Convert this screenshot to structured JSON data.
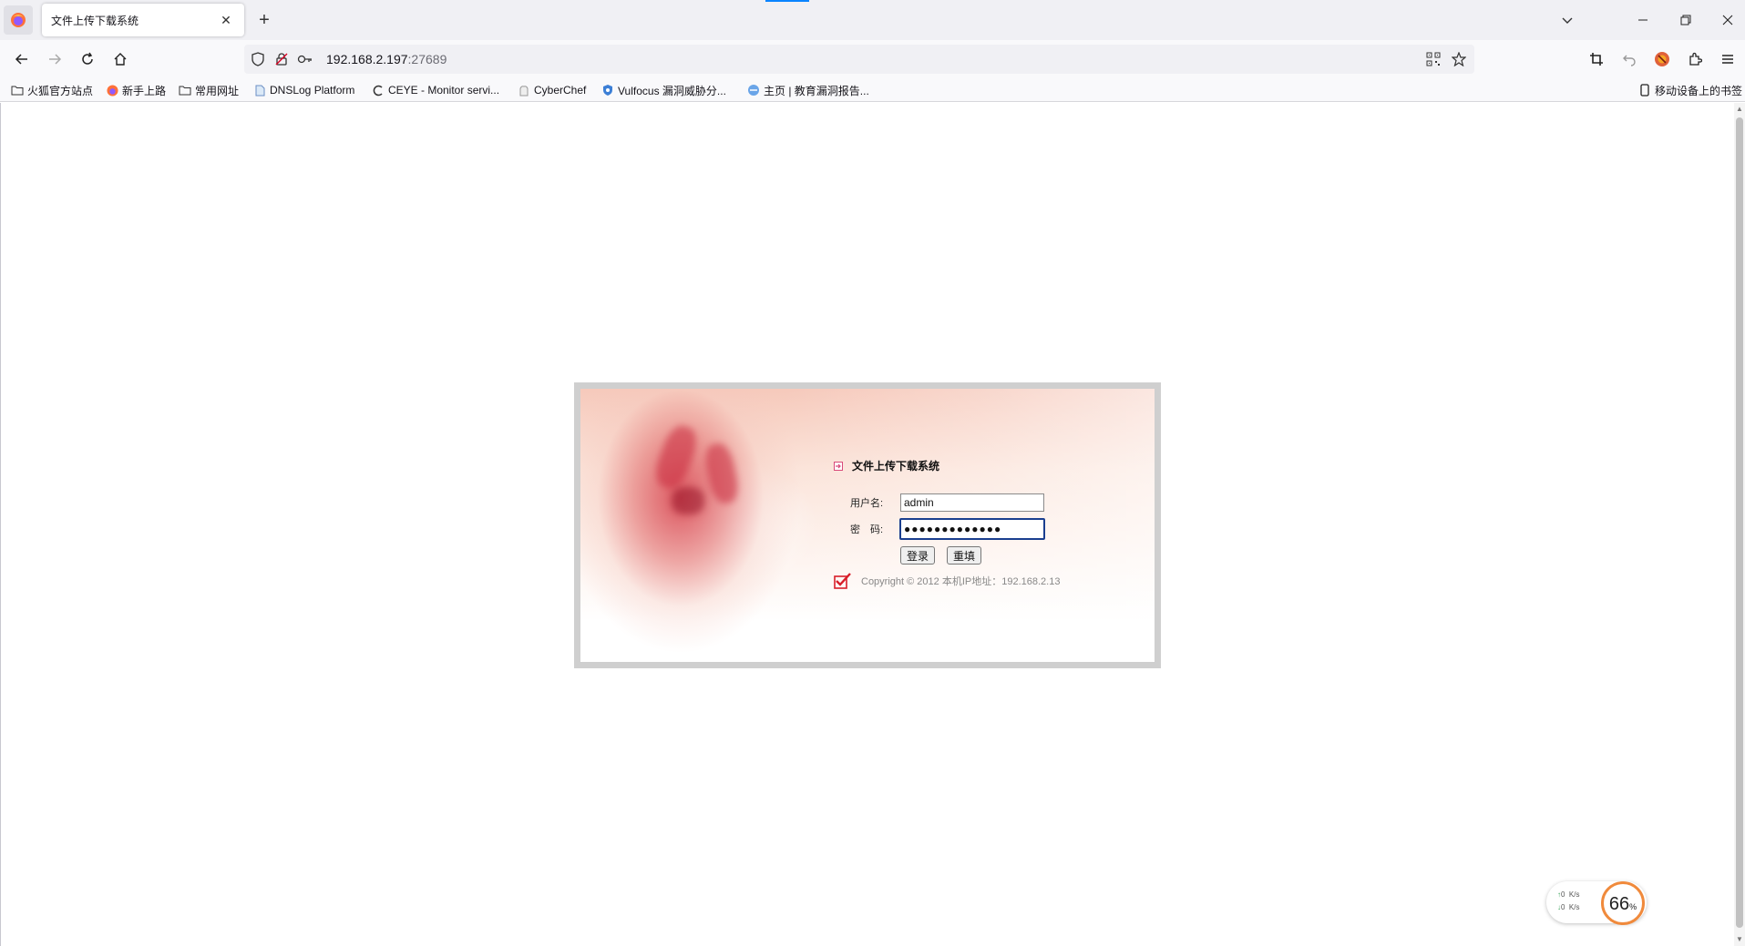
{
  "browser": {
    "tab": {
      "title": "文件上传下载系统"
    },
    "url": {
      "host": "192.168.2.197",
      "port": ":27689"
    },
    "bookmarks": [
      {
        "label": "火狐官方站点",
        "icon": "folder-icon"
      },
      {
        "label": "新手上路",
        "icon": "firefox-icon"
      },
      {
        "label": "常用网址",
        "icon": "folder-icon"
      },
      {
        "label": "DNSLog Platform",
        "icon": "page-icon"
      },
      {
        "label": "CEYE - Monitor servi...",
        "icon": "ceye-icon"
      },
      {
        "label": "CyberChef",
        "icon": "chef-icon"
      },
      {
        "label": "Vulfocus 漏洞威胁分...",
        "icon": "shield-icon"
      },
      {
        "label": "主页 | 教育漏洞报告...",
        "icon": "edu-icon"
      }
    ],
    "mobile_bookmarks": "移动设备上的书签"
  },
  "login": {
    "title": "文件上传下载系统",
    "username_label": "用户名:",
    "username_value": "admin",
    "password_label": "密　码:",
    "password_value": "●●●●●●●●●●●●●",
    "login_button": "登录",
    "reset_button": "重填",
    "copyright": "Copyright © 2012 本机IP地址：192.168.2.13"
  },
  "speed_widget": {
    "upload": "0",
    "download": "0",
    "unit": "K/s",
    "percent": "66",
    "percent_sign": "%"
  },
  "colors": {
    "accent": "#0a84ff",
    "frame": "#cfcfcf",
    "focus_border": "#1a3f8f",
    "check_red": "#d81e2a",
    "gauge_orange": "#f08a3c"
  }
}
